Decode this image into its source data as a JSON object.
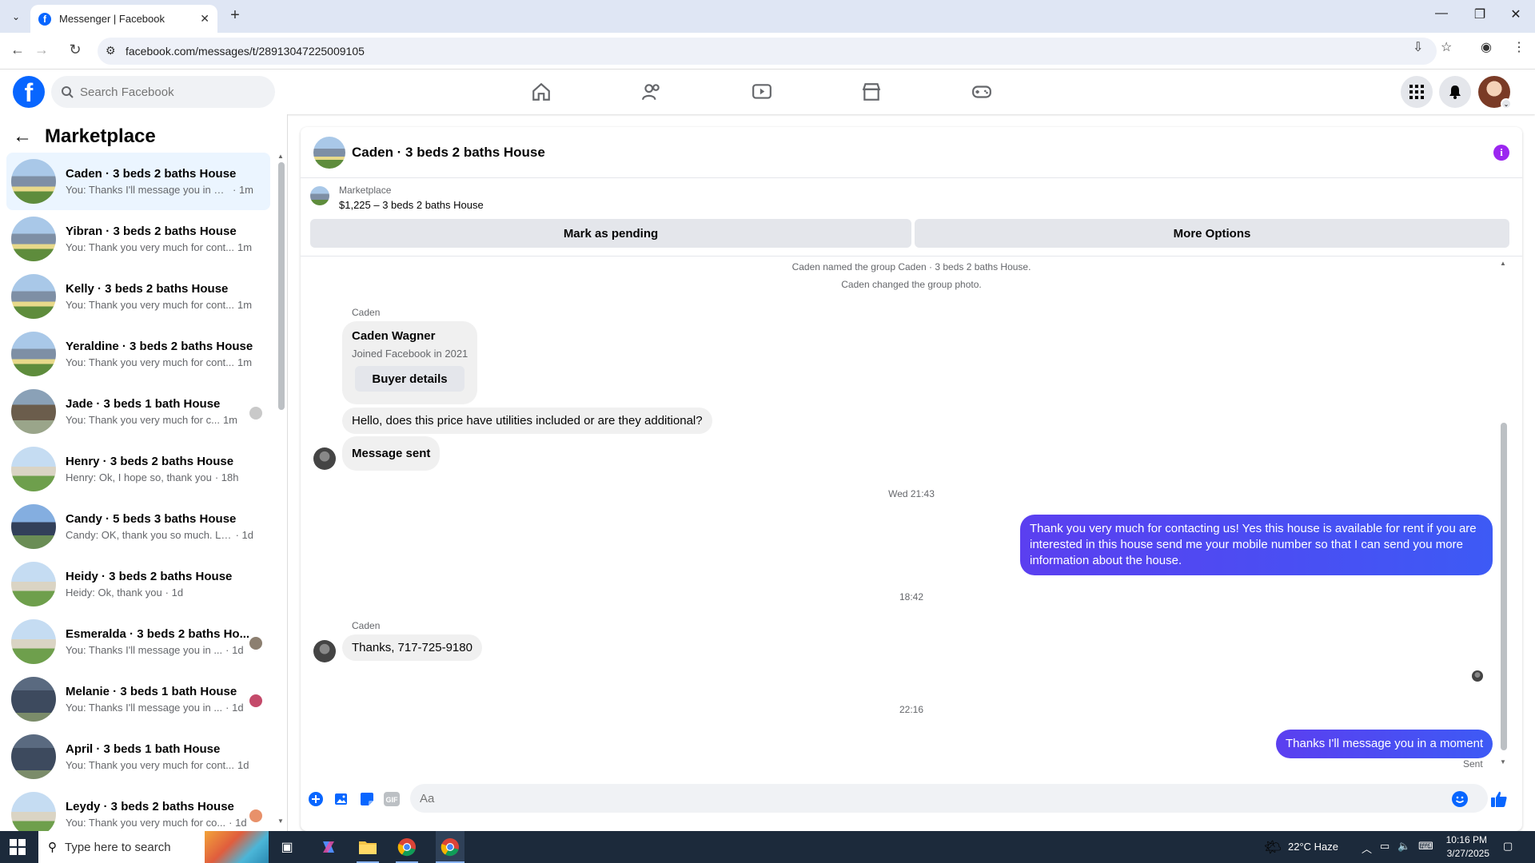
{
  "browser": {
    "tab_title": "Messenger | Facebook",
    "url": "facebook.com/messages/t/28913047225009105"
  },
  "fb": {
    "search_placeholder": "Search Facebook"
  },
  "left": {
    "title": "Marketplace",
    "conversations": [
      {
        "name": "Caden · 3 beds 2 baths House",
        "preview": "You: Thanks I'll message you in a ...",
        "time": "· 1m",
        "thumb": "h1"
      },
      {
        "name": "Yibran · 3 beds 2 baths House",
        "preview": "You: Thank you very much for cont...",
        "time": "1m",
        "thumb": "h1"
      },
      {
        "name": "Kelly · 3 beds 2 baths House",
        "preview": "You: Thank you very much for cont...",
        "time": "1m",
        "thumb": "h1"
      },
      {
        "name": "Yeraldine · 3 beds 2 baths House",
        "preview": "You: Thank you very much for cont...",
        "time": "1m",
        "thumb": "h1"
      },
      {
        "name": "Jade · 3 beds 1 bath House",
        "preview": "You: Thank you very much for c...",
        "time": "1m",
        "thumb": "h2"
      },
      {
        "name": "Henry · 3 beds 2 baths House",
        "preview": "Henry: Ok, I hope so, thank you",
        "time": "· 18h",
        "thumb": "h3"
      },
      {
        "name": "Candy · 5 beds 3 baths House",
        "preview": "Candy: OK, thank you so much. Loo...",
        "time": "· 1d",
        "thumb": "h4"
      },
      {
        "name": "Heidy · 3 beds 2 baths House",
        "preview": "Heidy: Ok, thank you",
        "time": "· 1d",
        "thumb": "h3"
      },
      {
        "name": "Esmeralda · 3 beds 2 baths Ho...",
        "preview": "You: Thanks I'll message you in ...",
        "time": "· 1d",
        "thumb": "h3"
      },
      {
        "name": "Melanie · 3 beds 1 bath House",
        "preview": "You: Thanks I'll message you in ...",
        "time": "· 1d",
        "thumb": "h5"
      },
      {
        "name": "April · 3 beds 1 bath House",
        "preview": "You: Thank you very much for cont...",
        "time": "1d",
        "thumb": "h5"
      },
      {
        "name": "Leydy · 3 beds 2 baths House",
        "preview": "You: Thank you very much for co...",
        "time": "· 1d",
        "thumb": "h3"
      }
    ]
  },
  "chat": {
    "title": "Caden · 3 beds 2 baths House",
    "marketplace_label": "Marketplace",
    "listing": "$1,225 – 3 beds 2 baths House",
    "mark_pending": "Mark as pending",
    "more_options": "More Options",
    "sys1": "Caden named the group Caden · 3 beds 2 baths House.",
    "sys2": "Caden changed the group photo.",
    "sender": "Caden",
    "card_name": "Caden Wagner",
    "card_joined": "Joined Facebook in 2021",
    "buyer_details": "Buyer details",
    "msg1": "Hello, does this price have utilities included or are they additional?",
    "msg2": "Message sent",
    "ts1": "Wed 21:43",
    "out1": "Thank you very much for contacting us! Yes this house is available for rent if you are interested in this house send me your mobile number so that I can send you more information about the house.",
    "ts2": "18:42",
    "msg3": "Thanks, 717-725-9180",
    "ts3": "22:16",
    "out2": "Thanks I'll message you in a moment",
    "sent": "Sent",
    "composer_placeholder": "Aa"
  },
  "taskbar": {
    "search": "Type here to search",
    "weather": "22°C  Haze",
    "time": "10:16 PM",
    "date": "3/27/2025"
  }
}
